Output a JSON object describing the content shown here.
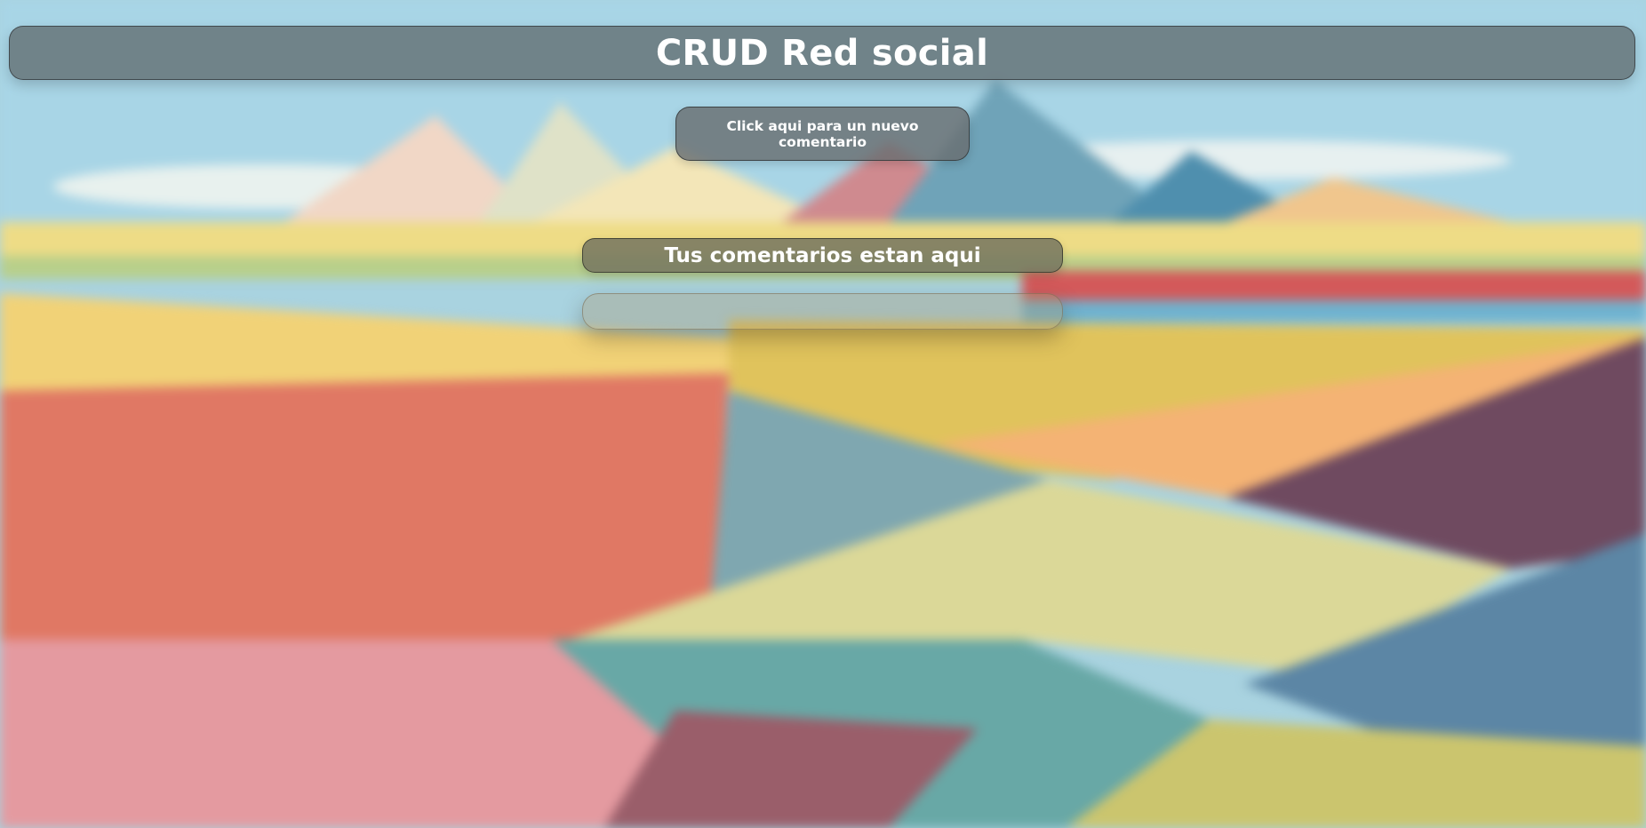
{
  "header": {
    "title": "CRUD Red social"
  },
  "actions": {
    "new_comment_label": "Click aqui para un nuevo comentario"
  },
  "comments": {
    "section_title": "Tus comentarios estan aqui",
    "items": []
  },
  "colors": {
    "text": "#ffffff",
    "panel": "#677174",
    "sky": "#a9d3e0"
  }
}
